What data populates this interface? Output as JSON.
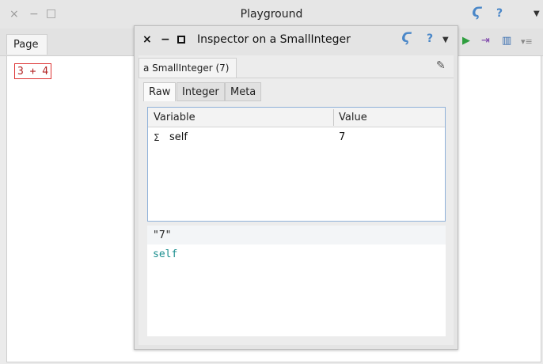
{
  "playground": {
    "title": "Playground",
    "controls": {
      "close": "×",
      "minimize": "−",
      "maximize": "□"
    },
    "tab_label": "Page",
    "code": "3 + 4",
    "toolbar": {
      "sync": "Ϛ",
      "help": "?",
      "menu": "▼",
      "run": "▶",
      "do_it": "⇥",
      "columns": "▥",
      "more": "▾≡"
    }
  },
  "inspector": {
    "title": "Inspector on a SmallInteger",
    "controls": {
      "close": "×",
      "minimize": "−"
    },
    "toolbar": {
      "sync": "Ϛ",
      "help": "?",
      "menu": "▼"
    },
    "tab_label": "a SmallInteger (7)",
    "edit_icon": "✎",
    "subtabs": [
      "Raw",
      "Integer",
      "Meta"
    ],
    "table": {
      "headers": {
        "variable": "Variable",
        "value": "Value"
      },
      "rows": [
        {
          "icon": "Σ",
          "variable": "self",
          "value": "7"
        }
      ]
    },
    "code_lines": [
      "\"7\"",
      "self"
    ]
  },
  "colors": {
    "accent": "#4a87c8",
    "run_green": "#2e9e3e",
    "code_teal": "#1a8e8e",
    "code_red": "#b22222"
  }
}
